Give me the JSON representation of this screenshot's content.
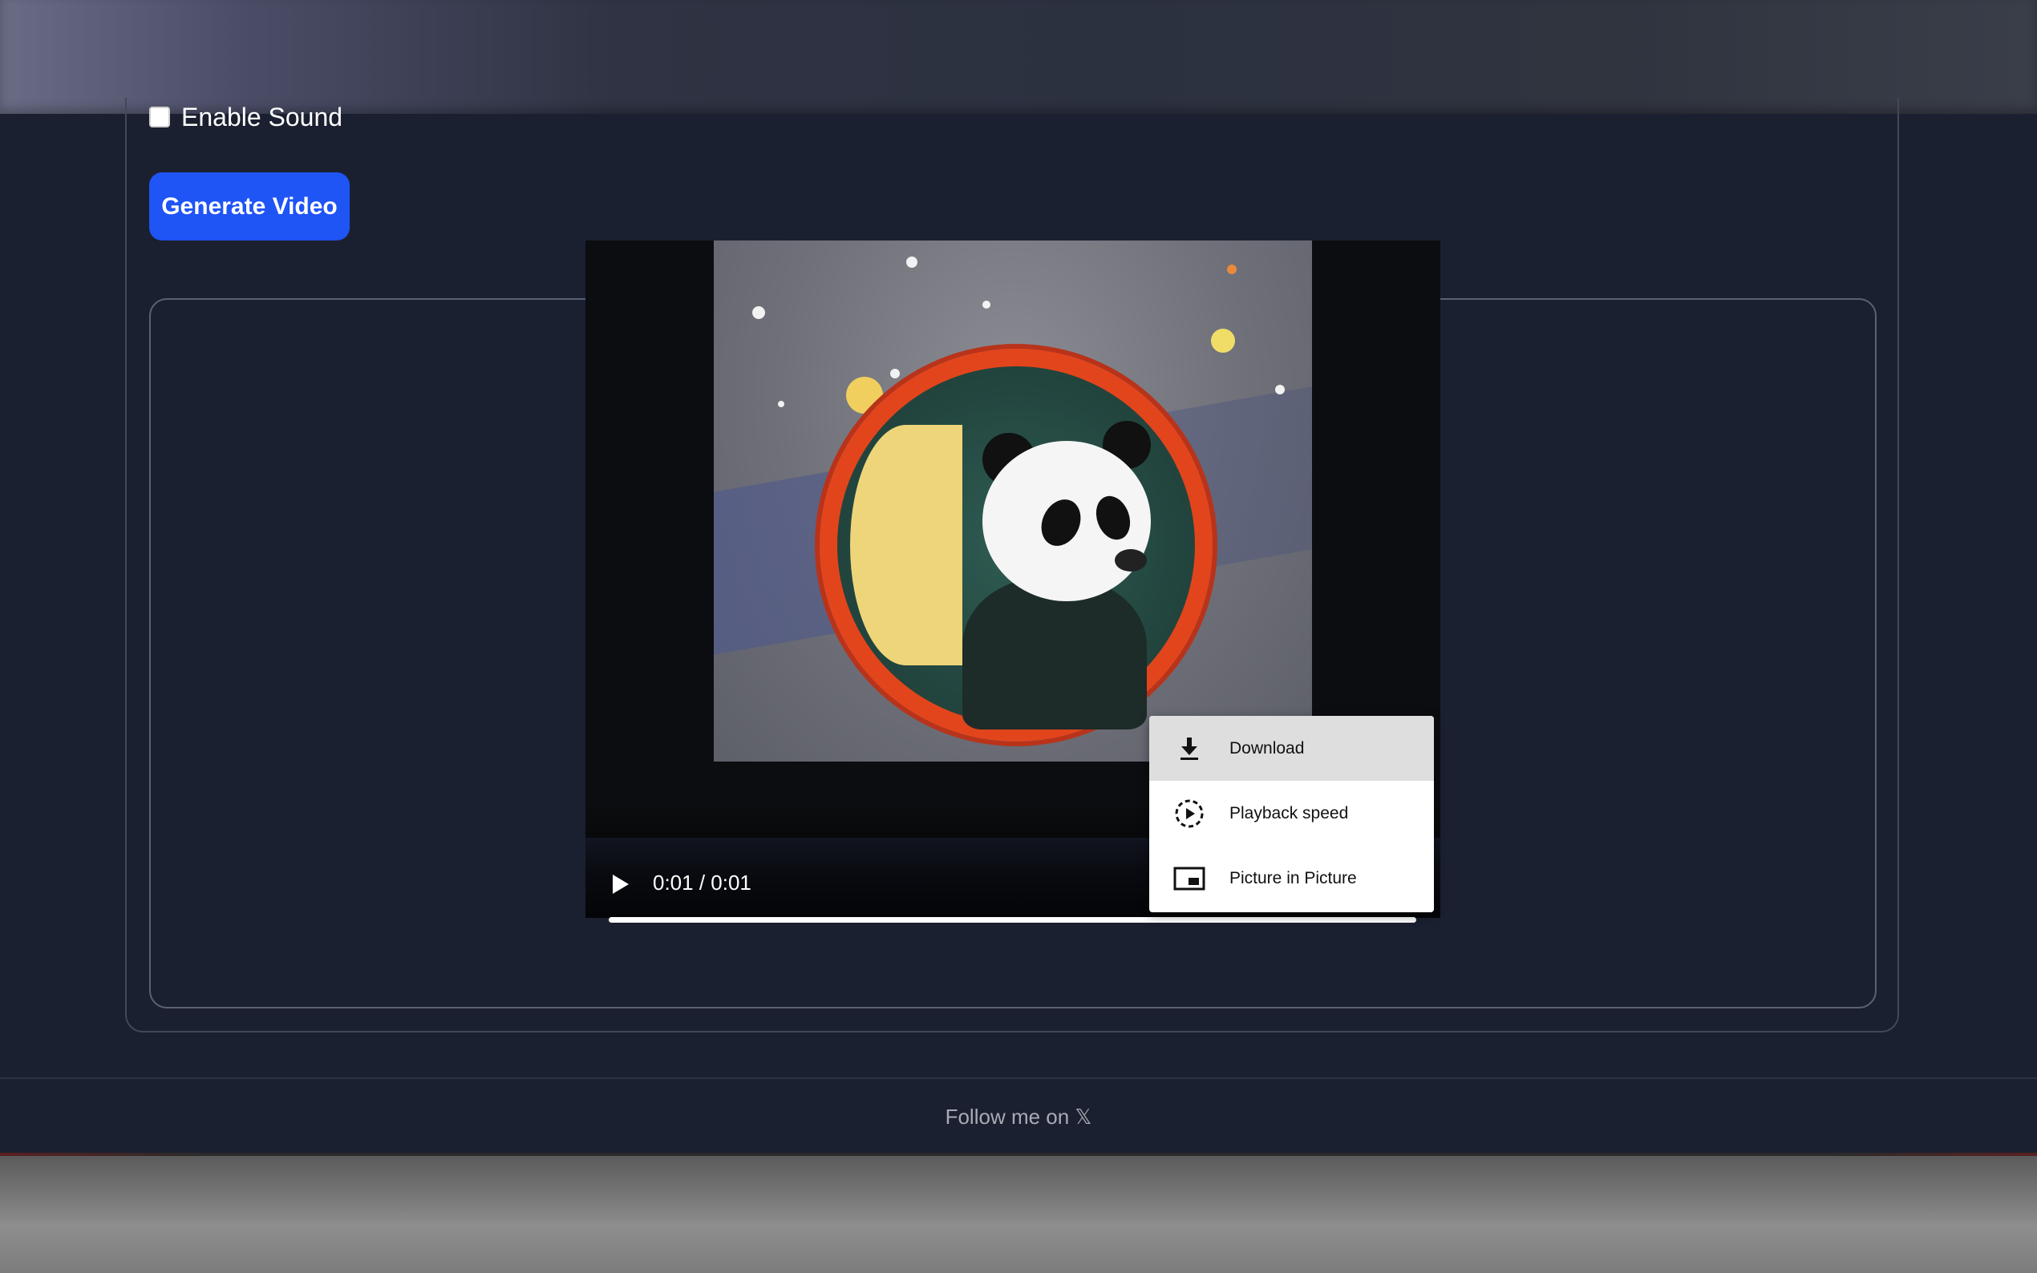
{
  "form": {
    "sound_label": "Enable Sound",
    "generate_label": "Generate Video"
  },
  "player": {
    "time": "0:01 / 0:01",
    "progress": 1.0
  },
  "context_menu": {
    "items": [
      {
        "label": "Download",
        "icon": "download-icon"
      },
      {
        "label": "Playback speed",
        "icon": "playback-speed-icon"
      },
      {
        "label": "Picture in Picture",
        "icon": "picture-in-picture-icon"
      }
    ]
  },
  "footer": {
    "text": "Follow me on 𝕏"
  },
  "colors": {
    "accent": "#1f54f5",
    "background": "#1b2030"
  }
}
